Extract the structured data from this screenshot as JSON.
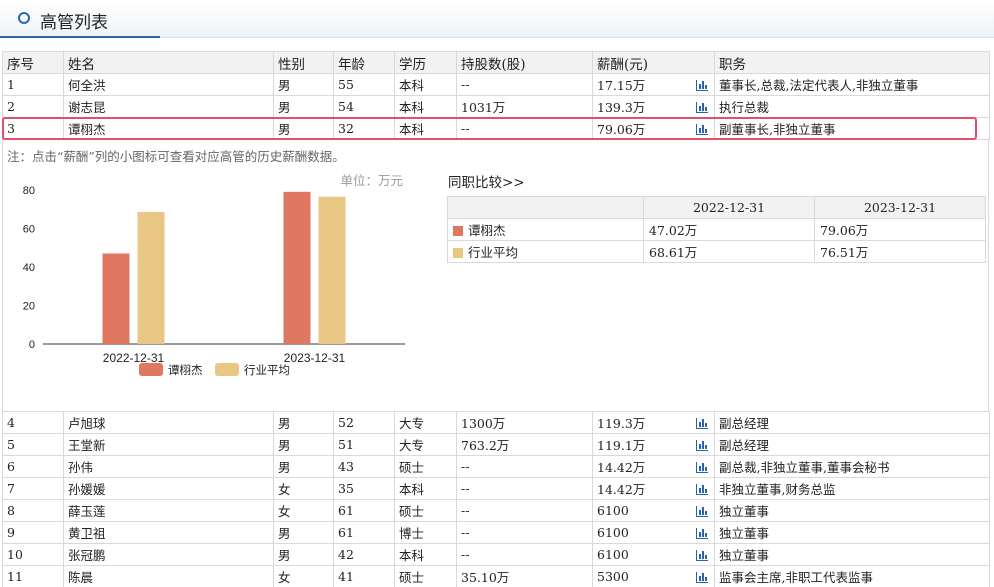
{
  "section": {
    "title": "高管列表"
  },
  "columns": [
    "序号",
    "姓名",
    "性别",
    "年龄",
    "学历",
    "持股数(股)",
    "薪酬(元)",
    "职务"
  ],
  "top_rows": [
    [
      "1",
      "何全洪",
      "男",
      "55",
      "本科",
      "--",
      "17.15万",
      "董事长,总裁,法定代表人,非独立董事"
    ],
    [
      "2",
      "谢志昆",
      "男",
      "54",
      "本科",
      "1031万",
      "139.3万",
      "执行总裁"
    ],
    [
      "3",
      "谭栩杰",
      "男",
      "32",
      "本科",
      "--",
      "79.06万",
      "副董事长,非独立董事"
    ]
  ],
  "note": "注：点击“薪酬”列的小图标可查看对应高管的历史薪酬数据。",
  "compare": {
    "title": "同职比较>>",
    "headers": [
      "",
      "2022-12-31",
      "2023-12-31"
    ],
    "rows": [
      [
        "谭栩杰",
        "47.02万",
        "79.06万"
      ],
      [
        "行业平均",
        "68.61万",
        "76.51万"
      ]
    ]
  },
  "bottom_rows": [
    [
      "4",
      "卢旭球",
      "男",
      "52",
      "大专",
      "1300万",
      "119.3万",
      "副总经理"
    ],
    [
      "5",
      "王堂新",
      "男",
      "51",
      "大专",
      "763.2万",
      "119.1万",
      "副总经理"
    ],
    [
      "6",
      "孙伟",
      "男",
      "43",
      "硕士",
      "--",
      "14.42万",
      "副总裁,非独立董事,董事会秘书"
    ],
    [
      "7",
      "孙媛媛",
      "女",
      "35",
      "本科",
      "--",
      "14.42万",
      "非独立董事,财务总监"
    ],
    [
      "8",
      "薛玉莲",
      "女",
      "61",
      "硕士",
      "--",
      "6100",
      "独立董事"
    ],
    [
      "9",
      "黄卫祖",
      "男",
      "61",
      "博士",
      "--",
      "6100",
      "独立董事"
    ],
    [
      "10",
      "张冠鹏",
      "男",
      "42",
      "本科",
      "--",
      "6100",
      "独立董事"
    ],
    [
      "11",
      "陈晨",
      "女",
      "41",
      "硕士",
      "35.10万",
      "5300",
      "监事会主席,非职工代表监事"
    ]
  ],
  "chart_data": {
    "type": "bar",
    "unit_label": "单位：万元",
    "categories": [
      "2022-12-31",
      "2023-12-31"
    ],
    "series": [
      {
        "name": "谭栩杰",
        "values": [
          47.02,
          79.06
        ],
        "color": "#e07760"
      },
      {
        "name": "行业平均",
        "values": [
          68.61,
          76.51
        ],
        "color": "#e8c683"
      }
    ],
    "yticks": [
      "0",
      "20",
      "40",
      "60",
      "80"
    ],
    "ylim": [
      0,
      80
    ],
    "legend": "bottom"
  }
}
